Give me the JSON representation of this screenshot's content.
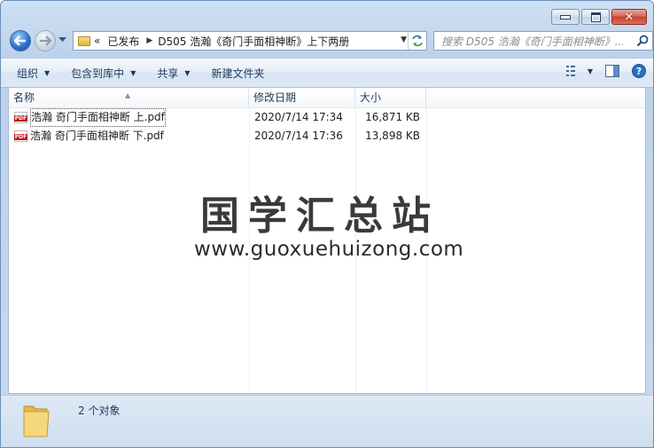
{
  "nav": {
    "address_segments": [
      "已发布",
      "D505 浩瀚《奇门手面相神断》上下两册"
    ],
    "address_overflow": "«",
    "search_placeholder": "搜索 D505 浩瀚《奇门手面相神断》..."
  },
  "toolbar": {
    "organize": "组织",
    "include_library": "包含到库中",
    "share": "共享",
    "new_folder": "新建文件夹"
  },
  "columns": {
    "name": "名称",
    "date": "修改日期",
    "size": "大小"
  },
  "files": [
    {
      "name": "浩瀚 奇门手面相神断 上.pdf",
      "date": "2020/7/14 17:34",
      "size": "16,871 KB",
      "icon": "pdf-icon"
    },
    {
      "name": "浩瀚 奇门手面相神断 下.pdf",
      "date": "2020/7/14 17:36",
      "size": "13,898 KB",
      "icon": "pdf-icon"
    }
  ],
  "watermark": {
    "title": "国学汇总站",
    "url": "www.guoxuehuizong.com"
  },
  "status": {
    "count": "2 个对象"
  }
}
